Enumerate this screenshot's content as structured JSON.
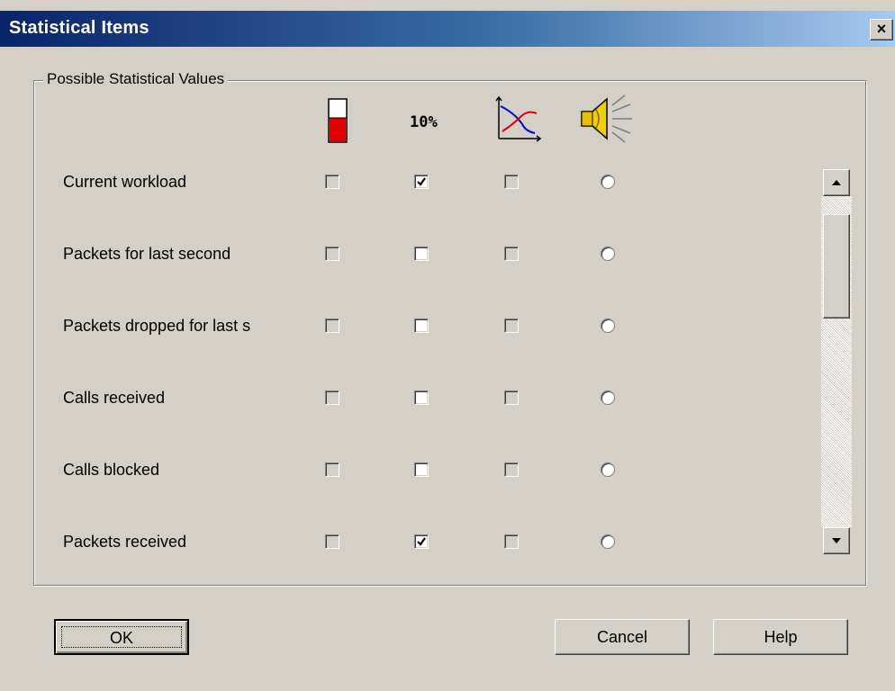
{
  "window": {
    "title": "Statistical Items",
    "close_glyph": "×"
  },
  "group": {
    "label": "Possible Statistical Values"
  },
  "columns": [
    {
      "icon": "thermometer-gauge-icon"
    },
    {
      "icon": "percentage-icon",
      "text": "10%"
    },
    {
      "icon": "graph-chart-icon"
    },
    {
      "icon": "speaker-alarm-icon"
    }
  ],
  "rows": [
    {
      "label": "Current workload",
      "gauge": false,
      "percent": true,
      "graph": false,
      "alarm": false
    },
    {
      "label": "Packets for last second",
      "gauge": false,
      "percent": false,
      "graph": false,
      "alarm": false
    },
    {
      "label": "Packets dropped for last s",
      "gauge": false,
      "percent": false,
      "graph": false,
      "alarm": false
    },
    {
      "label": "Calls received",
      "gauge": false,
      "percent": false,
      "graph": false,
      "alarm": false
    },
    {
      "label": "Calls blocked",
      "gauge": false,
      "percent": false,
      "graph": false,
      "alarm": false
    },
    {
      "label": "Packets received",
      "gauge": false,
      "percent": true,
      "graph": false,
      "alarm": false
    }
  ],
  "buttons": {
    "ok": "OK",
    "cancel": "Cancel",
    "help": "Help"
  },
  "colors": {
    "title_start": "#0a246a",
    "title_end": "#a6caf0",
    "face": "#d4d0c8",
    "gauge_red": "#e00000"
  }
}
